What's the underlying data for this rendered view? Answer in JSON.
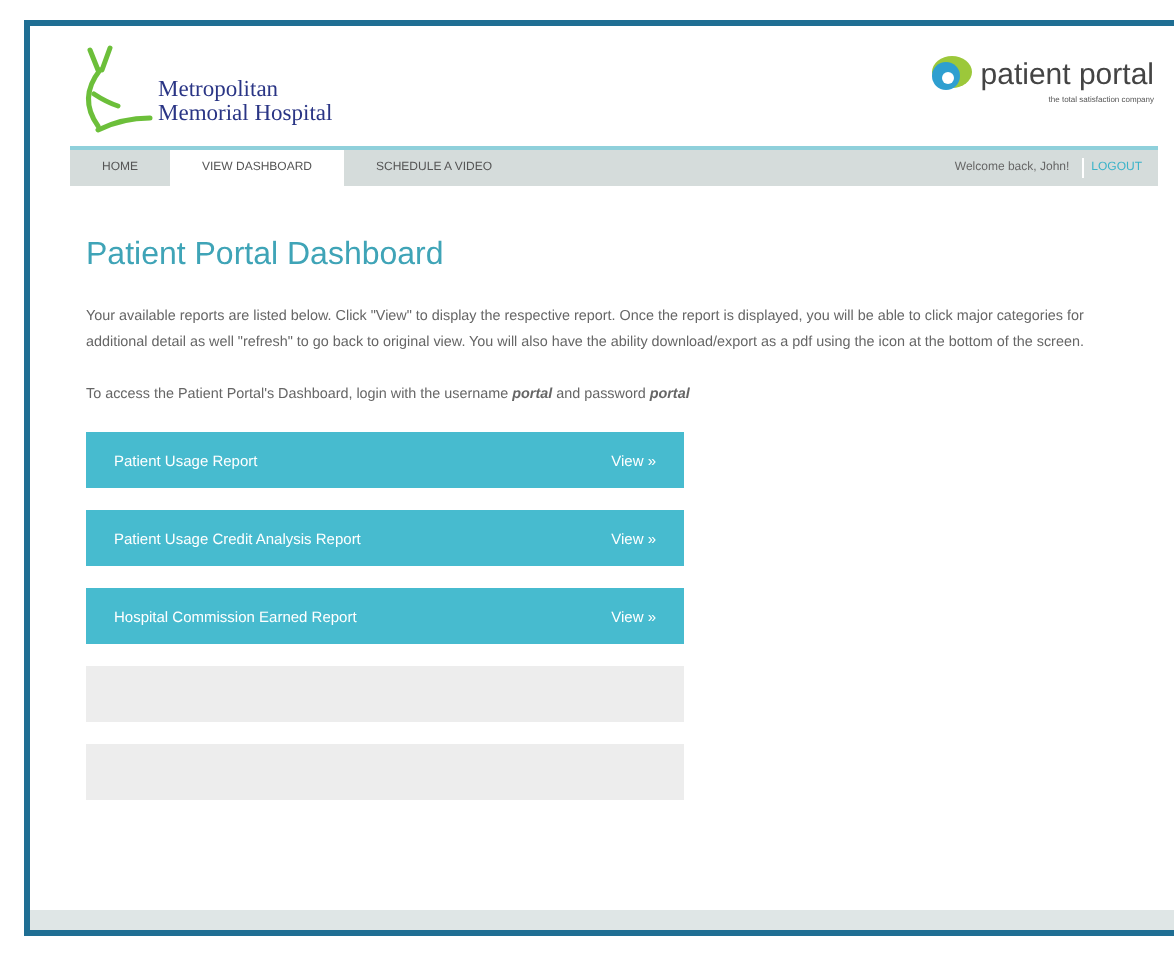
{
  "header": {
    "hospital_name": [
      "Metropolitan",
      "Memorial Hospital"
    ],
    "brand": "patient portal",
    "tagline": "the total satisfaction company"
  },
  "nav": {
    "tabs": [
      {
        "label": "HOME",
        "selected": false
      },
      {
        "label": "VIEW DASHBOARD",
        "selected": true
      },
      {
        "label": "SCHEDULE A VIDEO",
        "selected": false
      }
    ],
    "welcome": "Welcome back, John!",
    "logout": "LOGOUT"
  },
  "title": "Patient Portal Dashboard",
  "intro": "Your available reports are listed below. Click \"View\" to display the respective report. Once the report is displayed, you will be able to click major categories for additional detail as well \"refresh\" to go back to original view. You will also have the ability download/export as a pdf using the icon at the bottom of the screen.",
  "login_note": "To access the Patient Portal's Dashboard, login with the username **portal** and password **portal**",
  "reports": [
    {
      "label": "Patient Usage Report",
      "action": "View »",
      "disabled": false
    },
    {
      "label": "Patient Usage Credit Analysis Report",
      "action": "View »",
      "disabled": false
    },
    {
      "label": "Hospital Commission Earned Report",
      "action": "View »",
      "disabled": false
    },
    {
      "disabled": true
    },
    {
      "disabled": true
    }
  ]
}
